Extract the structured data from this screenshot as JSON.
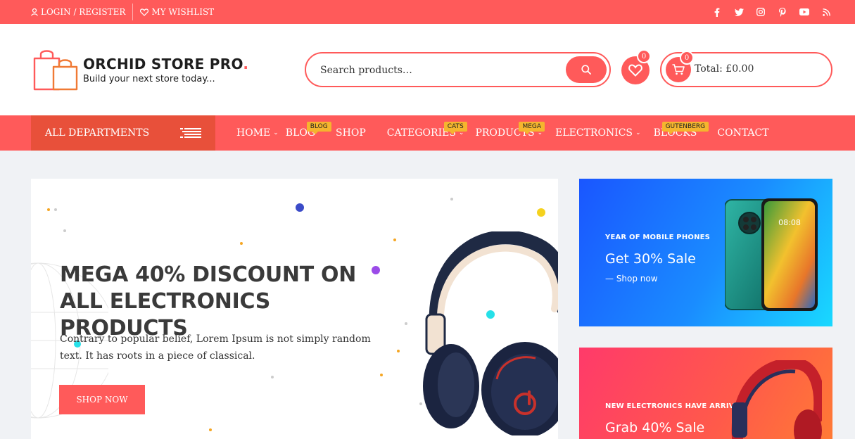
{
  "topbar": {
    "login_label": "LOGIN / REGISTER",
    "wishlist_label": "MY WISHLIST",
    "social": [
      "facebook-icon",
      "twitter-icon",
      "instagram-icon",
      "pinterest-icon",
      "youtube-icon",
      "rss-icon"
    ]
  },
  "logo": {
    "title": "ORCHID STORE PRO",
    "dot": ".",
    "tagline": "Build your next store today..."
  },
  "search": {
    "placeholder": "Search products…"
  },
  "wishlist": {
    "count": "0"
  },
  "cart": {
    "count": "0",
    "total": "Total: £0.00"
  },
  "nav": {
    "departments": "ALL DEPARTMENTS",
    "items": [
      {
        "label": "HOME"
      },
      {
        "label": "BLOG",
        "tag": "BLOG"
      },
      {
        "label": "SHOP"
      },
      {
        "label": "CATEGORIES",
        "tag": "CATS"
      },
      {
        "label": "PRODUCTS",
        "tag": "MEGA"
      },
      {
        "label": "ELECTRONICS"
      },
      {
        "label": "BLOCKS",
        "tag": "GUTENBERG"
      },
      {
        "label": "CONTACT"
      }
    ]
  },
  "hero": {
    "heading": "MEGA 40% DISCOUNT ON ALL ELECTRONICS PRODUCTS",
    "text": "Contrary to popular belief, Lorem Ipsum is not simply random text. It has roots in a piece of classical.",
    "button": "SHOP NOW"
  },
  "banner1": {
    "small": "YEAR OF MOBILE PHONES",
    "big": "Get 30% Sale",
    "link": "— Shop now"
  },
  "banner2": {
    "small": "NEW ELECTRONICS HAVE ARRIVED",
    "big": "Grab 40% Sale"
  },
  "colors": {
    "accent": "#ff5a5a",
    "dept": "#e8503a",
    "tag": "#f5b52e"
  }
}
